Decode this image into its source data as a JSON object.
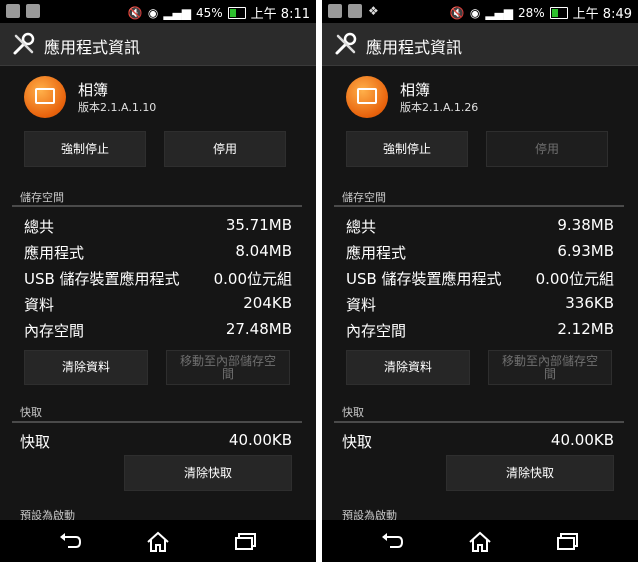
{
  "screens": [
    {
      "status": {
        "battery": "45%",
        "time": "上午 8:11"
      },
      "title": "應用程式資訊",
      "app": {
        "name": "相簿",
        "version": "版本2.1.A.1.10"
      },
      "buttons": {
        "force_stop": "強制停止",
        "disable": "停用",
        "disable_enabled": true
      },
      "storage": {
        "header": "儲存空間",
        "rows": [
          {
            "label": "總共",
            "value": "35.71MB"
          },
          {
            "label": "應用程式",
            "value": "8.04MB"
          },
          {
            "label": "USB 儲存裝置應用程式",
            "value": "0.00位元組"
          },
          {
            "label": "資料",
            "value": "204KB"
          },
          {
            "label": "內存空間",
            "value": "27.48MB"
          }
        ],
        "clear_data": "清除資料",
        "move": "移動至內部儲存空間"
      },
      "cache": {
        "header": "快取",
        "label": "快取",
        "value": "40.00KB",
        "clear": "清除快取"
      },
      "next_header": "預設為啟動"
    },
    {
      "status": {
        "battery": "28%",
        "time": "上午 8:49"
      },
      "title": "應用程式資訊",
      "app": {
        "name": "相簿",
        "version": "版本2.1.A.1.26"
      },
      "buttons": {
        "force_stop": "強制停止",
        "disable": "停用",
        "disable_enabled": false
      },
      "storage": {
        "header": "儲存空間",
        "rows": [
          {
            "label": "總共",
            "value": "9.38MB"
          },
          {
            "label": "應用程式",
            "value": "6.93MB"
          },
          {
            "label": "USB 儲存裝置應用程式",
            "value": "0.00位元組"
          },
          {
            "label": "資料",
            "value": "336KB"
          },
          {
            "label": "內存空間",
            "value": "2.12MB"
          }
        ],
        "clear_data": "清除資料",
        "move": "移動至內部儲存空間"
      },
      "cache": {
        "header": "快取",
        "label": "快取",
        "value": "40.00KB",
        "clear": "清除快取"
      },
      "next_header": "預設為啟動"
    }
  ]
}
